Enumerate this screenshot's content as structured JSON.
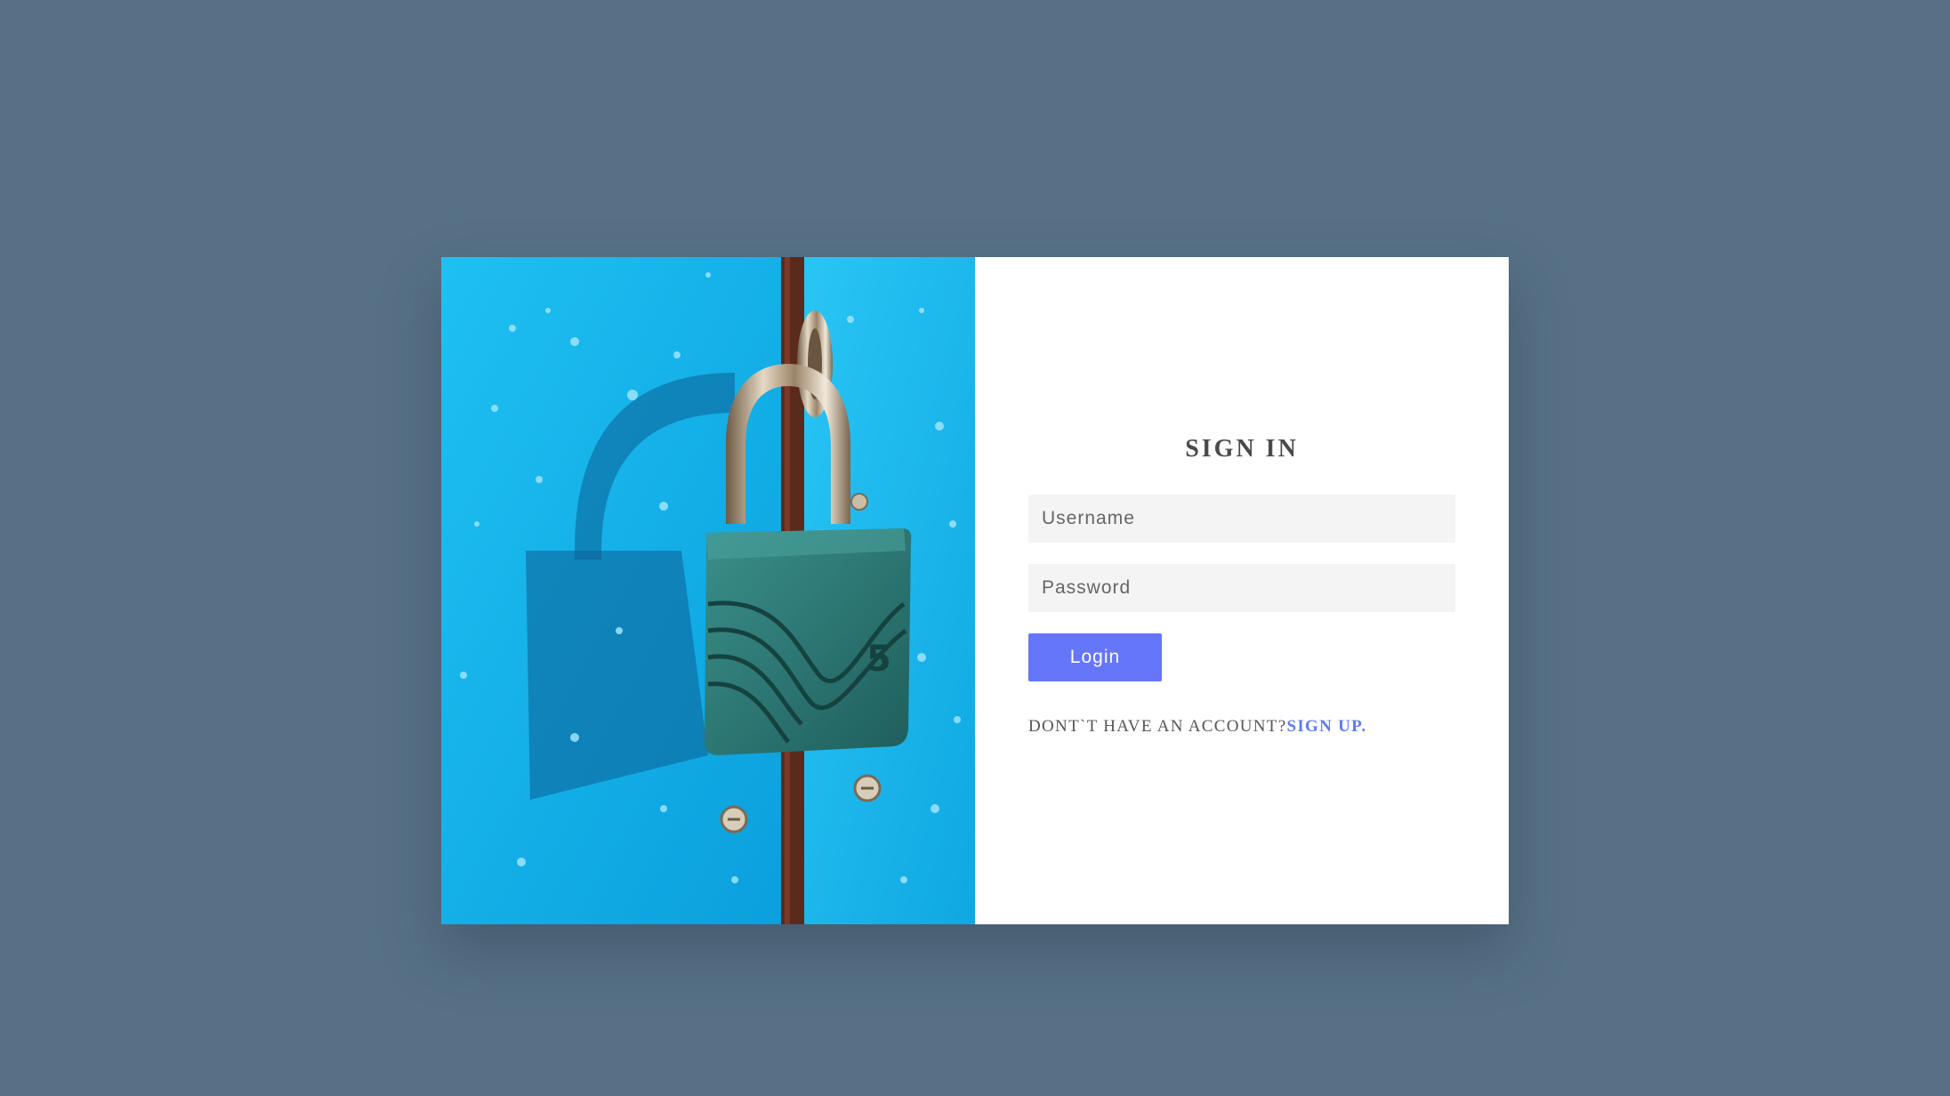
{
  "login": {
    "title": "SIGN IN",
    "username_placeholder": "Username",
    "password_placeholder": "Password",
    "login_label": "Login",
    "no_account_text": "DONT`T HAVE AN ACCOUNT?",
    "signup_label": "SIGN UP."
  },
  "colors": {
    "background": "#577086",
    "card_form_bg": "#ffffff",
    "input_bg": "#f4f4f4",
    "button_bg": "#6576fb",
    "link": "#5c7cf0",
    "image_blue": "#19b3ea",
    "padlock_body": "#2e7d7a"
  },
  "image": {
    "description_icon": "padlock-on-blue-door-photo"
  }
}
